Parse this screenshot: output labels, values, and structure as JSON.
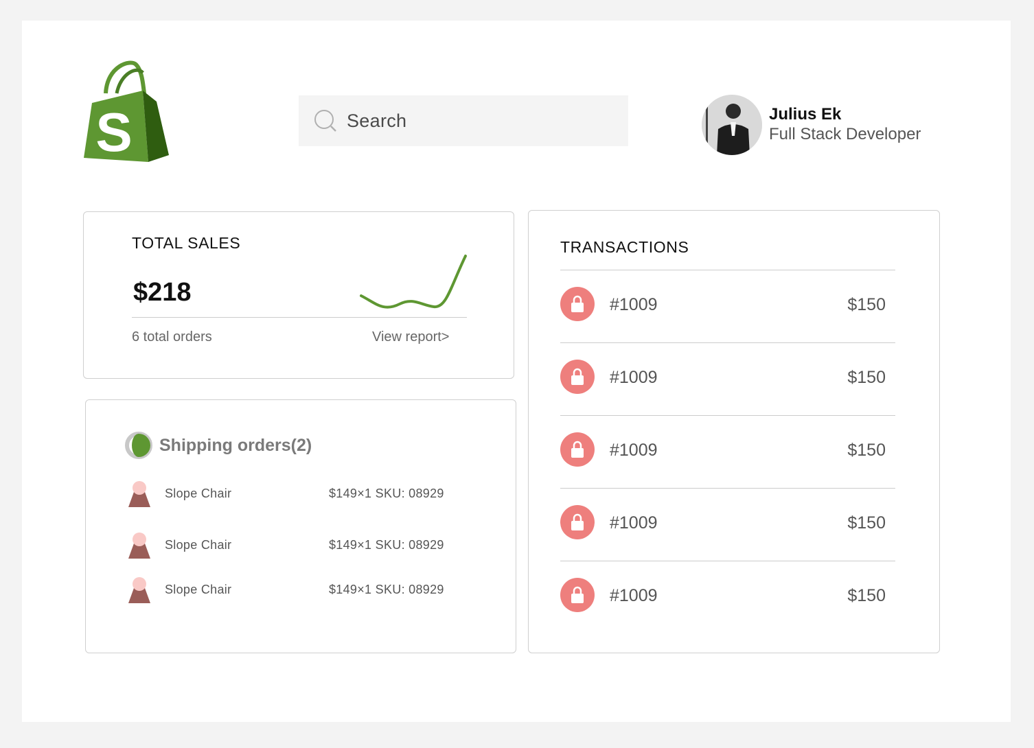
{
  "brand": {
    "logo_letter": "S",
    "logo_colors": {
      "light": "#5e9732",
      "dark": "#2f5d10"
    }
  },
  "search": {
    "placeholder": "Search",
    "icon": "search-icon"
  },
  "profile": {
    "name": "Julius Ek",
    "role": "Full Stack Developer",
    "avatar_icon": "user-avatar"
  },
  "total_sales": {
    "title": "TOTAL SALES",
    "value": "$218",
    "orders": "6 total orders",
    "link": "View report>",
    "trend_color": "#5e9732"
  },
  "shipping": {
    "title": "Shipping orders(2)",
    "icon": "status-ring-icon",
    "items": [
      {
        "name": "Slope Chair",
        "price": "$149×1  SKU: 08929"
      },
      {
        "name": "Slope Chair",
        "price": "$149×1  SKU: 08929"
      },
      {
        "name": "Slope Chair",
        "price": "$149×1  SKU: 08929"
      }
    ]
  },
  "transactions": {
    "title": "TRANSACTIONS",
    "icon_color": "#ee7f7d",
    "rows": [
      {
        "id": "#1009",
        "amount": "$150"
      },
      {
        "id": "#1009",
        "amount": "$150"
      },
      {
        "id": "#1009",
        "amount": "$150"
      },
      {
        "id": "#1009",
        "amount": "$150"
      },
      {
        "id": "#1009",
        "amount": "$150"
      }
    ]
  }
}
